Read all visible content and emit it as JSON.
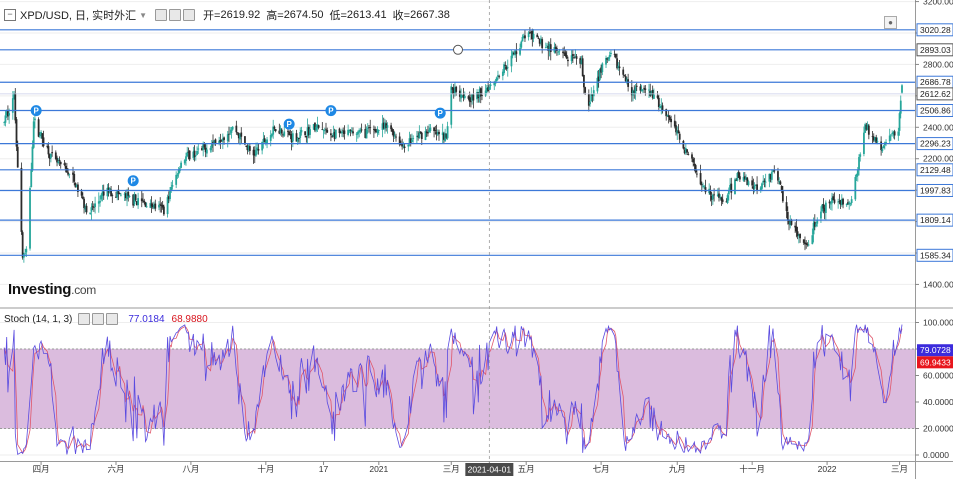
{
  "header": {
    "symbol": "XPD/USD, 日, 实时外汇",
    "open_label": "开=",
    "open": "2619.92",
    "high_label": "高=",
    "high": "2674.50",
    "low_label": "低=",
    "low": "2613.41",
    "close_label": "收=",
    "close": "2667.38"
  },
  "logo": {
    "name": "Investing",
    "suffix": ".com"
  },
  "stoch": {
    "label": "Stoch (14, 1, 3)",
    "k_value": "77.0184",
    "d_value": "68.9880"
  },
  "colors": {
    "up": "#26a69a",
    "down": "#2b2b2b",
    "hline": "#3c78d8",
    "stoch_band": "#d9b8dc",
    "k_line": "#5a4be0",
    "d_line": "#e0566a",
    "k_badge": "#3b2bdc",
    "d_badge": "#e8161d"
  },
  "chart_data": [
    {
      "type": "candlestick",
      "title": "XPD/USD, 日, 实时外汇",
      "y_axis": {
        "min": 1400,
        "max": 3200,
        "tick_labels": [
          "3200.00",
          "3000.00",
          "2800.00",
          "2600.00",
          "2400.00",
          "2200.00",
          "2000.00",
          "1800.00",
          "1600.00",
          "1400.00"
        ]
      },
      "x_tick_labels": [
        "四月",
        "六月",
        "八月",
        "十月",
        "17",
        "2021",
        "三月",
        "2021-04-01",
        "五月",
        "七月",
        "九月",
        "十一月",
        "2022",
        "三月"
      ],
      "horizontal_lines": [
        "3020.28",
        "2893.03",
        "2686.78",
        "2506.86",
        "2296.23",
        "2129.48",
        "1997.83",
        "1809.14",
        "1585.34"
      ],
      "highlighted_labels": [
        "2893.03",
        "2612.62"
      ],
      "last_price_label": "2612.62",
      "crosshair_x_label": "2021-04-01",
      "marker_label": "P",
      "price_anchors": [
        [
          "2020-03-01",
          2420
        ],
        [
          "2020-03-10",
          2600
        ],
        [
          "2020-03-17",
          1580
        ],
        [
          "2020-03-20",
          1600
        ],
        [
          "2020-03-26",
          2440
        ],
        [
          "2020-04-10",
          2200
        ],
        [
          "2020-04-25",
          2100
        ],
        [
          "2020-05-10",
          1850
        ],
        [
          "2020-05-25",
          2000
        ],
        [
          "2020-06-10",
          1950
        ],
        [
          "2020-07-10",
          1880
        ],
        [
          "2020-07-25",
          2200
        ],
        [
          "2020-08-10",
          2250
        ],
        [
          "2020-09-05",
          2400
        ],
        [
          "2020-09-20",
          2220
        ],
        [
          "2020-10-10",
          2400
        ],
        [
          "2020-10-25",
          2330
        ],
        [
          "2020-11-10",
          2400
        ],
        [
          "2020-11-25",
          2350
        ],
        [
          "2020-12-20",
          2370
        ],
        [
          "2021-01-10",
          2400
        ],
        [
          "2021-01-20",
          2280
        ],
        [
          "2021-02-10",
          2380
        ],
        [
          "2021-02-25",
          2330
        ],
        [
          "2021-03-01",
          2650
        ],
        [
          "2021-03-20",
          2580
        ],
        [
          "2021-04-05",
          2700
        ],
        [
          "2021-04-20",
          2850
        ],
        [
          "2021-05-01",
          3000
        ],
        [
          "2021-05-15",
          2930
        ],
        [
          "2021-06-01",
          2850
        ],
        [
          "2021-06-15",
          2800
        ],
        [
          "2021-06-20",
          2500
        ],
        [
          "2021-07-01",
          2780
        ],
        [
          "2021-07-10",
          2860
        ],
        [
          "2021-07-25",
          2640
        ],
        [
          "2021-08-10",
          2620
        ],
        [
          "2021-08-25",
          2470
        ],
        [
          "2021-09-05",
          2300
        ],
        [
          "2021-09-25",
          2000
        ],
        [
          "2021-10-10",
          1920
        ],
        [
          "2021-10-20",
          2100
        ],
        [
          "2021-11-05",
          2020
        ],
        [
          "2021-11-20",
          2130
        ],
        [
          "2021-12-01",
          1800
        ],
        [
          "2021-12-15",
          1620
        ],
        [
          "2021-12-25",
          1850
        ],
        [
          "2022-01-10",
          1950
        ],
        [
          "2022-01-20",
          1900
        ],
        [
          "2022-02-01",
          2400
        ],
        [
          "2022-02-15",
          2270
        ],
        [
          "2022-02-28",
          2400
        ],
        [
          "2022-03-03",
          2620
        ]
      ]
    },
    {
      "type": "line",
      "title": "Stoch (14, 1, 3)",
      "y_axis": {
        "min": 0,
        "max": 100,
        "tick_labels": [
          "100.0000",
          "80.0000",
          "60.0000",
          "40.0000",
          "20.0000",
          "0.0000"
        ]
      },
      "band": [
        20,
        80
      ],
      "series": [
        {
          "name": "%K",
          "last_value": "79.0728"
        },
        {
          "name": "%D",
          "last_value": "69.9433"
        }
      ]
    }
  ]
}
